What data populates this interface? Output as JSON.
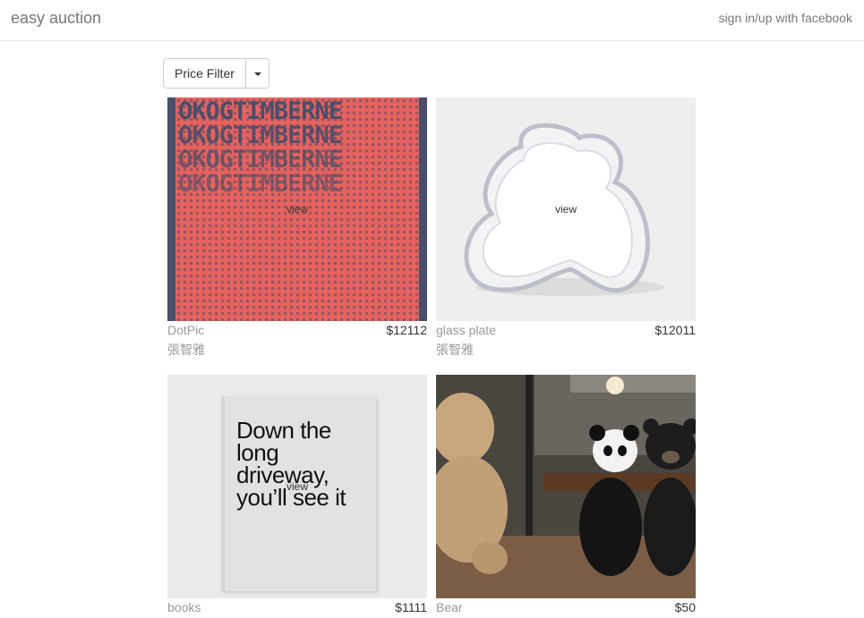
{
  "navbar": {
    "brand": "easy auction",
    "signin": "sign in/up with facebook"
  },
  "filter": {
    "label": "Price Filter",
    "caret_icon": "caret-down-icon"
  },
  "items": [
    {
      "title": "DotPic",
      "price": "$12112",
      "owner": "張智雅",
      "view_label": "view",
      "image_text": "OKOGTIMBERNE"
    },
    {
      "title": "glass plate",
      "price": "$12011",
      "owner": "張智雅",
      "view_label": "view"
    },
    {
      "title": "books",
      "price": "$1111",
      "view_label": "view",
      "image_text": "Down the long driveway, you’ll see it"
    },
    {
      "title": "Bear",
      "price": "$50"
    }
  ],
  "colors": {
    "dot_red": "#e8625d",
    "dot_navy": "#4a4e6b",
    "muted_text": "#999999"
  }
}
